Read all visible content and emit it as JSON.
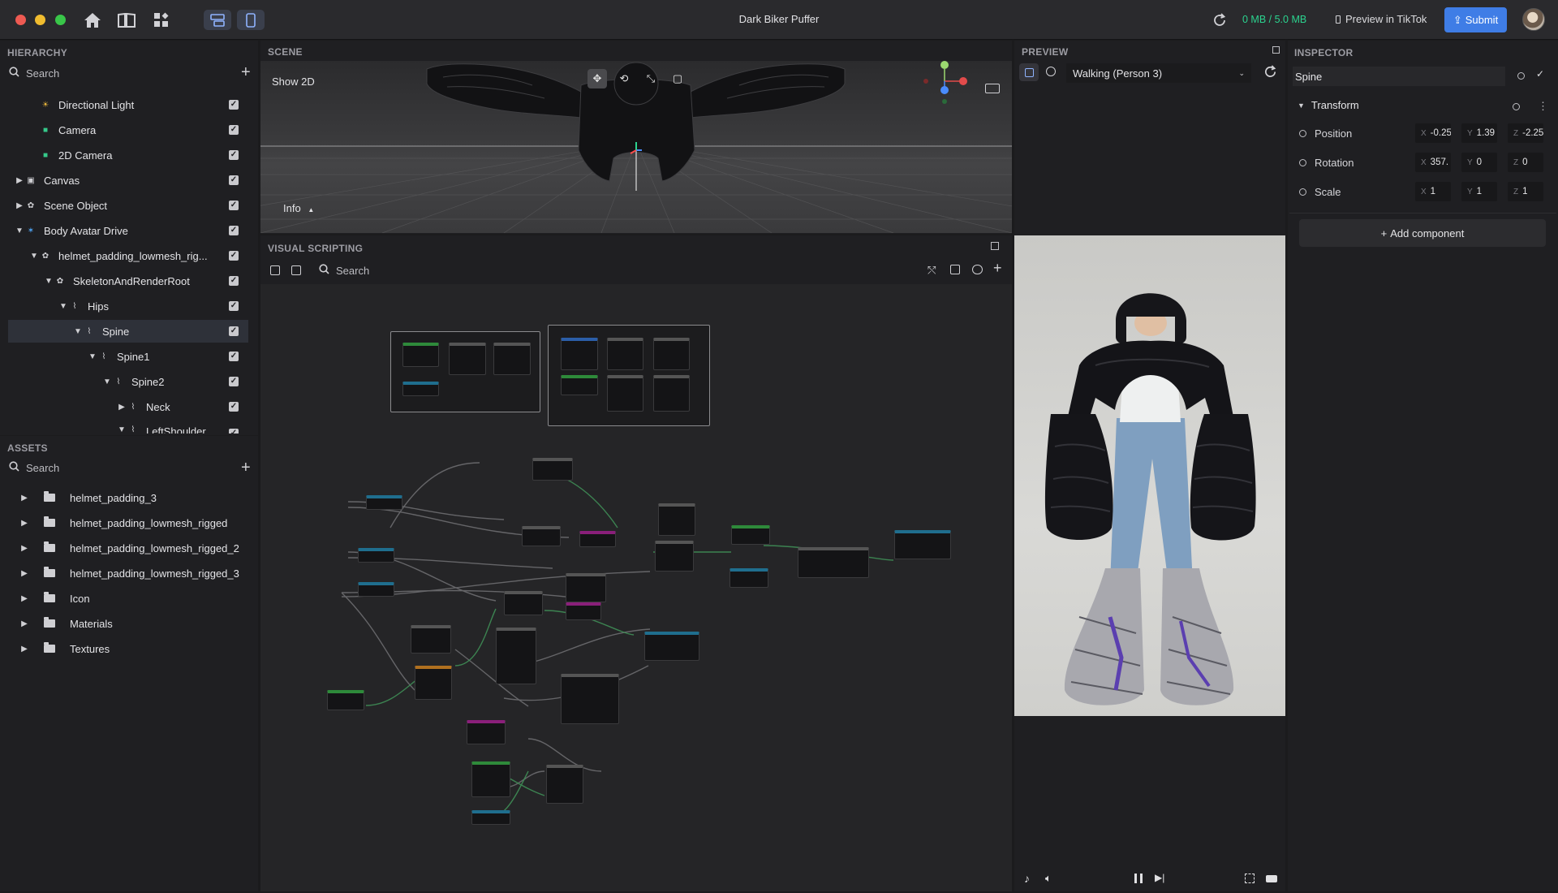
{
  "app": {
    "title": "Dark Biker Puffer",
    "size_label": "0 MB / 5.0 MB",
    "preview_label": "Preview in TikTok",
    "submit_label": "Submit",
    "colors": {
      "accent": "#3f7de6",
      "size_ok": "#2bd38f"
    }
  },
  "hierarchy": {
    "title": "HIERARCHY",
    "search_placeholder": "Search",
    "items": [
      {
        "label": "Directional Light",
        "icon": "sun-icon",
        "icon_color": "#e7b43c"
      },
      {
        "label": "Camera",
        "icon": "camera-icon",
        "icon_color": "#35c98a"
      },
      {
        "label": "2D Camera",
        "icon": "camera-icon",
        "icon_color": "#35c98a"
      },
      {
        "label": "Canvas",
        "icon": "canvas-icon"
      },
      {
        "label": "Scene Object",
        "icon": "object-icon"
      },
      {
        "label": "Body Avatar Drive",
        "icon": "avatar-icon",
        "icon_color": "#4ea3f1"
      },
      {
        "label": "helmet_padding_lowmesh_rig...",
        "icon": "object-icon"
      },
      {
        "label": "SkeletonAndRenderRoot",
        "icon": "object-icon"
      },
      {
        "label": "Hips",
        "icon": "bone-icon"
      },
      {
        "label": "Spine",
        "icon": "bone-icon"
      },
      {
        "label": "Spine1",
        "icon": "bone-icon"
      },
      {
        "label": "Spine2",
        "icon": "bone-icon"
      },
      {
        "label": "Neck",
        "icon": "bone-icon"
      },
      {
        "label": "LeftShoulder",
        "icon": "bone-icon"
      }
    ]
  },
  "assets": {
    "title": "ASSETS",
    "search_placeholder": "Search",
    "items": [
      "helmet_padding_3",
      "helmet_padding_lowmesh_rigged",
      "helmet_padding_lowmesh_rigged_2",
      "helmet_padding_lowmesh_rigged_3",
      "Icon",
      "Materials",
      "Textures"
    ]
  },
  "scene": {
    "title": "SCENE",
    "show2d_label": "Show 2D",
    "info_label": "Info"
  },
  "visual_scripting": {
    "title": "VISUAL SCRIPTING",
    "search_placeholder": "Search"
  },
  "preview": {
    "title": "PREVIEW",
    "animation_select": "Walking (Person 3)"
  },
  "inspector": {
    "title": "INSPECTOR",
    "object_name": "Spine",
    "component": "Transform",
    "properties": [
      {
        "label": "Position",
        "x": "-0.25",
        "y": "1.39",
        "z": "-2.25"
      },
      {
        "label": "Rotation",
        "x": "357.",
        "y": "0",
        "z": "0"
      },
      {
        "label": "Scale",
        "x": "1",
        "y": "1",
        "z": "1"
      }
    ],
    "add_component_label": "Add component"
  }
}
